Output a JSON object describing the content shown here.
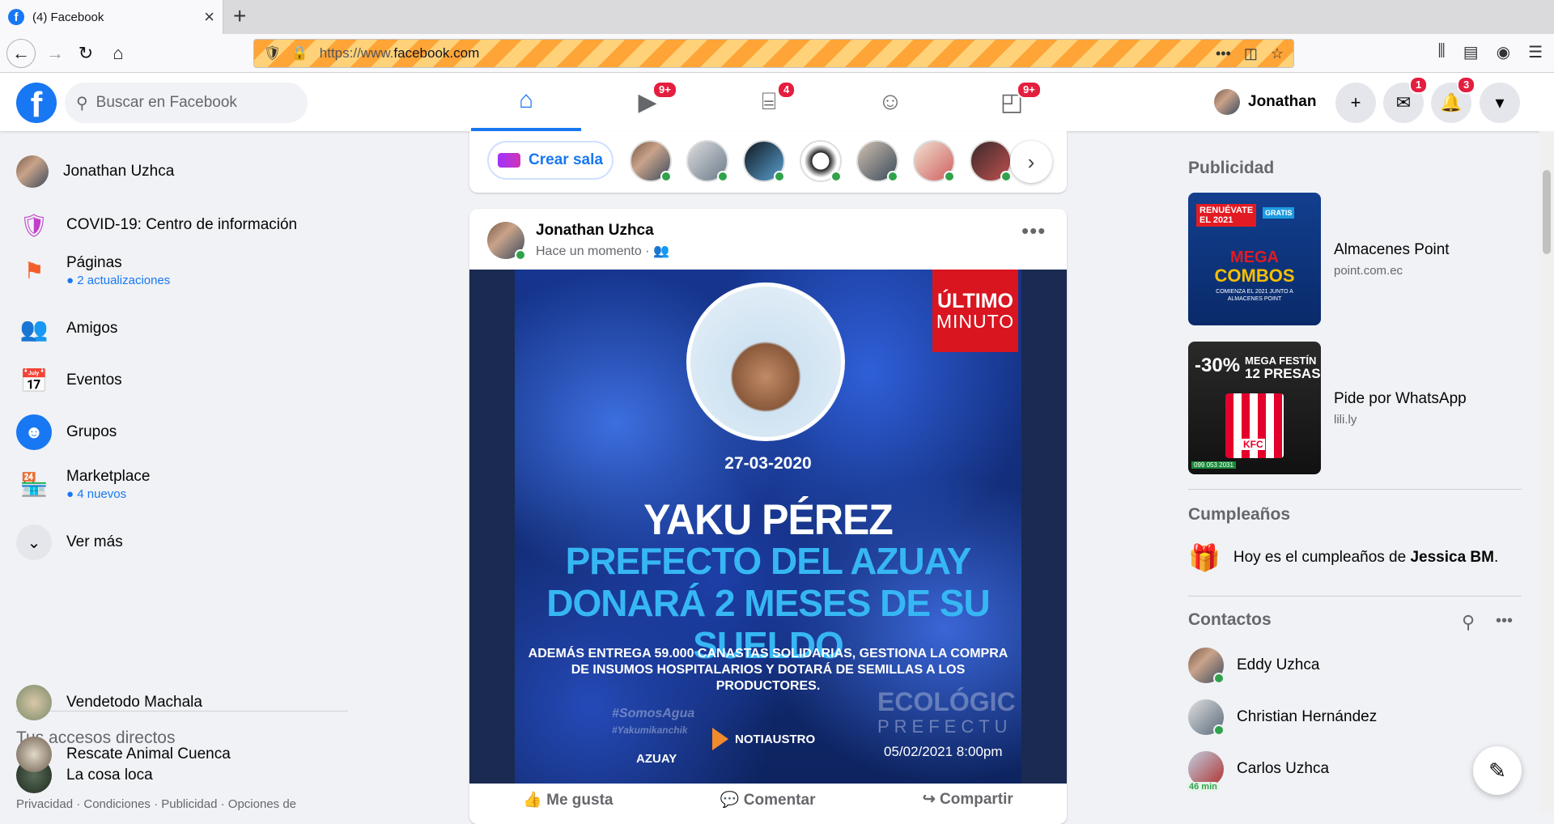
{
  "browser": {
    "tab_title": "(4) Facebook",
    "url_prefix": "https://www.",
    "url_domain": "facebook.com"
  },
  "header": {
    "search_placeholder": "Buscar en Facebook",
    "profile_name": "Jonathan",
    "badges": {
      "watch": "9+",
      "marketplace": "4",
      "gaming": "9+",
      "messenger": "1",
      "notifications": "3"
    },
    "accent": "#1877f2"
  },
  "sidebar": {
    "items": [
      {
        "label": "Jonathan Uzhca",
        "sub": ""
      },
      {
        "label": "COVID-19: Centro de información",
        "sub": ""
      },
      {
        "label": "Páginas",
        "sub": "● 2 actualizaciones"
      },
      {
        "label": "Amigos",
        "sub": ""
      },
      {
        "label": "Eventos",
        "sub": ""
      },
      {
        "label": "Grupos",
        "sub": ""
      },
      {
        "label": "Marketplace",
        "sub": "● 4 nuevos"
      },
      {
        "label": "Ver más",
        "sub": ""
      }
    ],
    "shortcuts_title": "Tus accesos directos",
    "shortcuts": [
      "La cosa loca",
      "Vendetodo Machala",
      "Rescate Animal Cuenca"
    ],
    "footer": "Privacidad · Condiciones · Publicidad · Opciones de"
  },
  "rooms": {
    "create_label": "Crear sala"
  },
  "post": {
    "author": "Jonathan Uzhca",
    "time": "Hace un momento ·",
    "image": {
      "badge_line1": "ÚLTIMO",
      "badge_line2": "MINUTO",
      "date": "27-03-2020",
      "title": "YAKU PÉREZ",
      "subtitle": "PREFECTO DEL AZUAY DONARÁ 2 MESES DE SU SUELDO",
      "body": "ADEMÁS ENTREGA 59.000 CANASTAS SOLIDARIAS, GESTIONA LA COMPRA DE INSUMOS HOSPITALARIOS Y DOTARÁ DE SEMILLAS A LOS PRODUCTORES.",
      "hashtag1": "#SomosAgua",
      "hashtag2": "#Yakumikanchik",
      "watermark1": "ECOLÓGIC",
      "watermark2": "PREFECTU",
      "source": "NOTIAUSTRO",
      "logo": "AZUAY",
      "timestamp": "05/02/2021 8:00pm"
    },
    "actions": {
      "like": "Me gusta",
      "comment": "Comentar",
      "share": "Compartir"
    }
  },
  "right": {
    "ads_title": "Publicidad",
    "ads": [
      {
        "title": "Almacenes Point",
        "domain": "point.com.ec",
        "img_top": "RENUÉVATE",
        "img_sub": "EL 2021",
        "img_mid": "MEGA",
        "img_big": "COMBOS",
        "img_small": "GRATIS",
        "img_caption": "COMIENZA EL 2021 JUNTO A ALMACENES POINT"
      },
      {
        "title": "Pide por WhatsApp",
        "domain": "lili.ly",
        "img_top": "-30%",
        "img_mid": "MEGA FESTÍN",
        "img_big": "12 PRESAS",
        "img_brand": "KFC",
        "img_phone": "099 053 2031"
      }
    ],
    "birthdays_title": "Cumpleaños",
    "birthday_text": "Hoy es el cumpleaños de ",
    "birthday_name": "Jessica BM",
    "birthday_end": ".",
    "contacts_title": "Contactos",
    "contacts": [
      {
        "name": "Eddy Uzhca",
        "status": ""
      },
      {
        "name": "Christian Hernández",
        "status": ""
      },
      {
        "name": "Carlos Uzhca",
        "status": "46 min"
      }
    ]
  }
}
